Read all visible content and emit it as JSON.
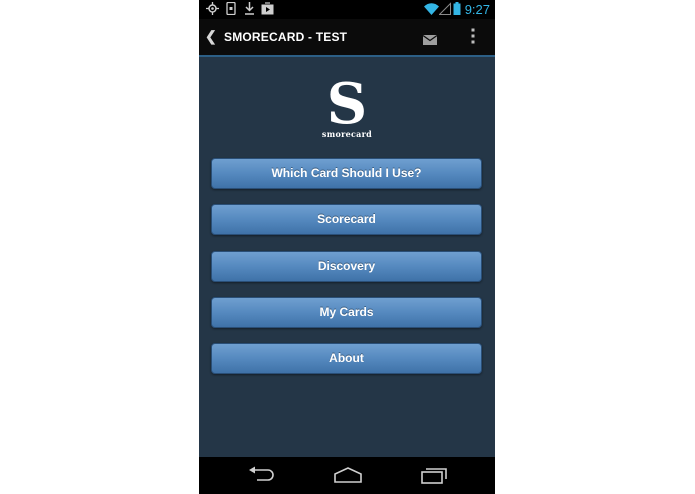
{
  "status_bar": {
    "time": "9:27",
    "icons": [
      "gps-icon",
      "phone-icon",
      "download-icon",
      "media-icon",
      "wifi-icon",
      "signal-icon",
      "battery-icon"
    ]
  },
  "action_bar": {
    "title": "SMORECARD - TEST",
    "actions": [
      "mail-icon",
      "overflow-menu-icon"
    ]
  },
  "logo": {
    "letter": "S",
    "wordmark": "smorecard"
  },
  "menu": {
    "items": [
      {
        "label": "Which Card Should I Use?"
      },
      {
        "label": "Scorecard"
      },
      {
        "label": "Discovery"
      },
      {
        "label": "My Cards"
      },
      {
        "label": "About"
      }
    ]
  },
  "nav_bar": {
    "icons": [
      "back-icon",
      "home-icon",
      "recents-icon"
    ]
  },
  "colors": {
    "content_bg": "#243647",
    "button": "#5589bf",
    "accent": "#33b5e5"
  }
}
